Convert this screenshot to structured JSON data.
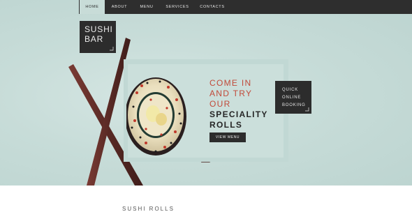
{
  "nav": {
    "items": [
      {
        "label": "HOME",
        "active": true
      },
      {
        "label": "ABOUT",
        "active": false
      },
      {
        "label": "MENU",
        "active": false
      },
      {
        "label": "SERVICES",
        "active": false
      },
      {
        "label": "CONTACTS",
        "active": false
      }
    ]
  },
  "logo": {
    "line1": "SUSHI",
    "line2": "BAR"
  },
  "hero": {
    "headline_red": [
      "COME IN",
      "AND TRY",
      "OUR"
    ],
    "headline_dark": [
      "SPECIALITY",
      "ROLLS"
    ],
    "cta_label": "VIEW MENU"
  },
  "quick_booking": {
    "lines": [
      "QUICK",
      "ONLINE",
      "BOOKING"
    ]
  },
  "section_heading_partial": "SUSHI ROLLS",
  "colors": {
    "nav_bg": "#2e2e2e",
    "hero_bg": "#c7dcd8",
    "accent_red": "#c14a3a",
    "dark_box": "#2c2c2c"
  },
  "icons": {
    "corner": "corner-ornament-icon",
    "photo": "sushi-roll-image"
  }
}
